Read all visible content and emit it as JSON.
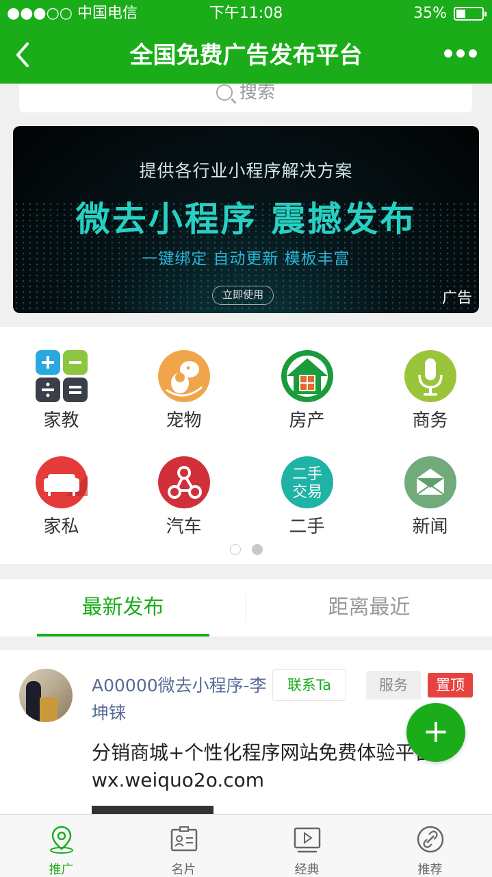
{
  "status_bar": {
    "carrier": "●●●○○ 中国电信",
    "time": "下午11:08",
    "battery": "35%",
    "battery_level": 0.35
  },
  "header": {
    "title": "全国免费广告发布平台"
  },
  "search": {
    "placeholder": "搜索"
  },
  "banner": {
    "subtitle": "提供各行业小程序解决方案",
    "headline": "微去小程序  震撼发布",
    "features": "一键绑定  自动更新  模板丰富",
    "button": "立即使用",
    "ad_label": "广告"
  },
  "categories": [
    {
      "label": "家教",
      "icon": "math-grid-icon"
    },
    {
      "label": "宠物",
      "icon": "pet-icon"
    },
    {
      "label": "房产",
      "icon": "house-icon"
    },
    {
      "label": "商务",
      "icon": "microphone-icon"
    },
    {
      "label": "家私",
      "icon": "sofa-icon"
    },
    {
      "label": "汽车",
      "icon": "share-nodes-icon"
    },
    {
      "label": "二手",
      "icon": "secondhand-icon",
      "icon_text": "二手\n交易"
    },
    {
      "label": "新闻",
      "icon": "envelope-icon"
    }
  ],
  "pager": {
    "pages": 2,
    "current": 2
  },
  "tabs": [
    {
      "label": "最新发布",
      "active": true
    },
    {
      "label": "距离最近",
      "active": false
    }
  ],
  "post": {
    "name": "A00000微去小程序-李坤铼",
    "contact_button": "联系Ta",
    "category": "服务",
    "pinned": "置顶",
    "content": "分销商城+个性化程序网站免费体验平台：wx.weiquo2o.com"
  },
  "fab": {
    "label": "+"
  },
  "tabbar": [
    {
      "label": "推广",
      "icon": "location-pin-icon",
      "active": true
    },
    {
      "label": "名片",
      "icon": "id-card-icon",
      "active": false
    },
    {
      "label": "经典",
      "icon": "video-play-icon",
      "active": false
    },
    {
      "label": "推荐",
      "icon": "link-icon",
      "active": false
    }
  ],
  "colors": {
    "brand_green": "#1aad19",
    "link_blue": "#576b95",
    "pinned_red": "#e64340"
  }
}
